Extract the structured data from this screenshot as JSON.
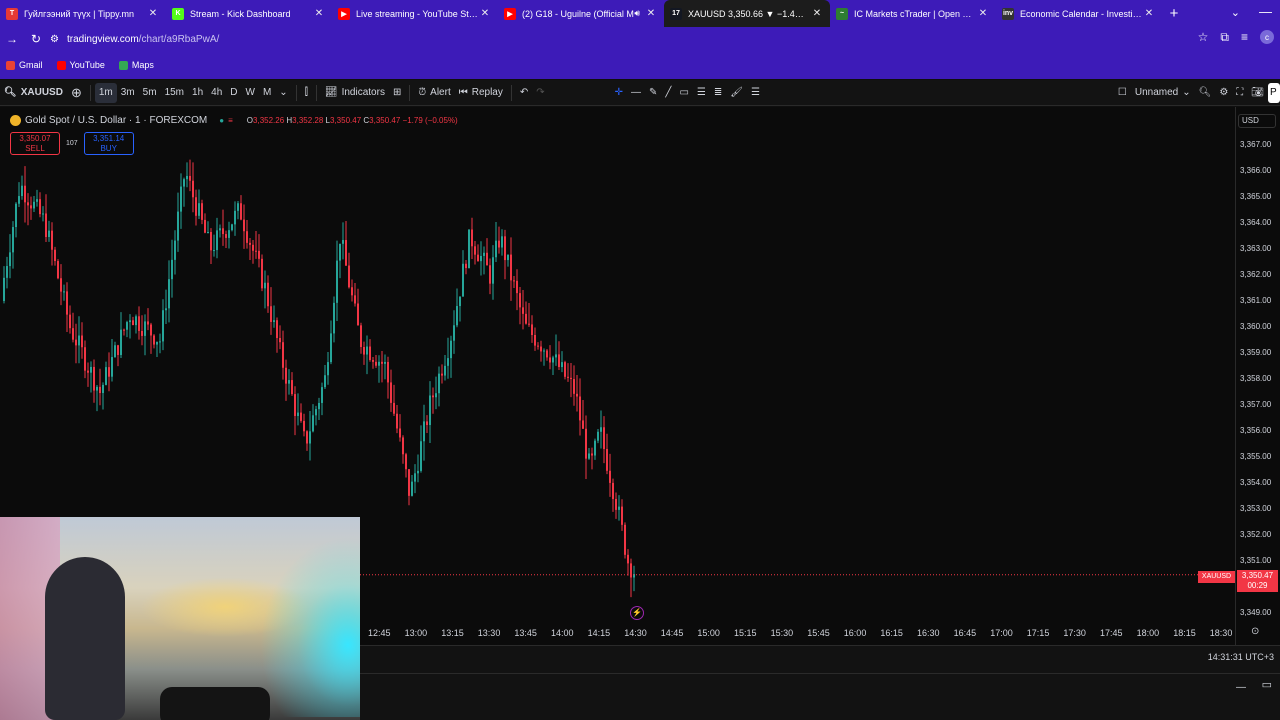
{
  "tabs": [
    {
      "title": "Гуйлгээний түүх | Tippy.mn",
      "fav_color": "#e53935",
      "fav_text": "T"
    },
    {
      "title": "Stream - Kick Dashboard",
      "fav_color": "#53fc18",
      "fav_text": "K"
    },
    {
      "title": "Live streaming - YouTube Studio",
      "fav_color": "#ff0000",
      "fav_text": "▶"
    },
    {
      "title": "(2) G18 - Uguilne (Official M",
      "fav_color": "#ff0000",
      "fav_text": "▶"
    },
    {
      "title": "XAUUSD 3,350.66 ▼ −1.4% Un",
      "fav_color": "#131722",
      "fav_text": "17",
      "active": true
    },
    {
      "title": "IC Markets cTrader | Open Trad",
      "fav_color": "#2e7d32",
      "fav_text": "~"
    },
    {
      "title": "Economic Calendar - Investing",
      "fav_color": "#333333",
      "fav_text": "inv"
    }
  ],
  "address": {
    "host": "tradingview.com",
    "path": "/chart/a9RbaPwA/"
  },
  "bookmarks": [
    {
      "label": "Gmail",
      "color": "#ea4335"
    },
    {
      "label": "YouTube",
      "color": "#ff0000"
    },
    {
      "label": "Maps",
      "color": "#34a853"
    }
  ],
  "toolbar": {
    "symbol": "XAUUSD",
    "intervals": [
      "1m",
      "3m",
      "5m",
      "15m",
      "1h",
      "4h",
      "D",
      "W",
      "M"
    ],
    "selected_interval": "1m",
    "indicators": "Indicators",
    "alert": "Alert",
    "replay": "Replay",
    "layout_name": "Unnamed"
  },
  "legend": {
    "title": "Gold Spot / U.S. Dollar · 1 · FOREXCOM",
    "o": "3,352.26",
    "h": "3,352.28",
    "l": "3,350.47",
    "c": "3,350.47",
    "change": "−1.79 (−0.05%)"
  },
  "trade": {
    "sell": "3,350.07",
    "sell_label": "SELL",
    "spread": "107",
    "buy": "3,351.14",
    "buy_label": "BUY"
  },
  "price_scale": {
    "currency": "USD",
    "labels": [
      "3,367.00",
      "3,366.00",
      "3,365.00",
      "3,364.00",
      "3,363.00",
      "3,362.00",
      "3,361.00",
      "3,360.00",
      "3,359.00",
      "3,358.00",
      "3,357.00",
      "3,356.00",
      "3,355.00",
      "3,354.00",
      "3,353.00",
      "3,352.00",
      "3,351.00",
      "3,349.00"
    ],
    "current": "3,350.47",
    "countdown": "00:29",
    "symbol_tag": "XAUUSD"
  },
  "time_axis": [
    "12:45",
    "13:00",
    "13:15",
    "13:30",
    "13:45",
    "14:00",
    "14:15",
    "14:30",
    "14:45",
    "15:00",
    "15:15",
    "15:30",
    "15:45",
    "16:00",
    "16:15",
    "16:30",
    "16:45",
    "17:00",
    "17:15",
    "17:30",
    "17:45",
    "18:00",
    "18:15",
    "18:30"
  ],
  "clock": "14:31:31 UTC+3",
  "colors": {
    "up": "#26a69a",
    "down": "#f23645",
    "accent": "#3d1bb8"
  }
}
